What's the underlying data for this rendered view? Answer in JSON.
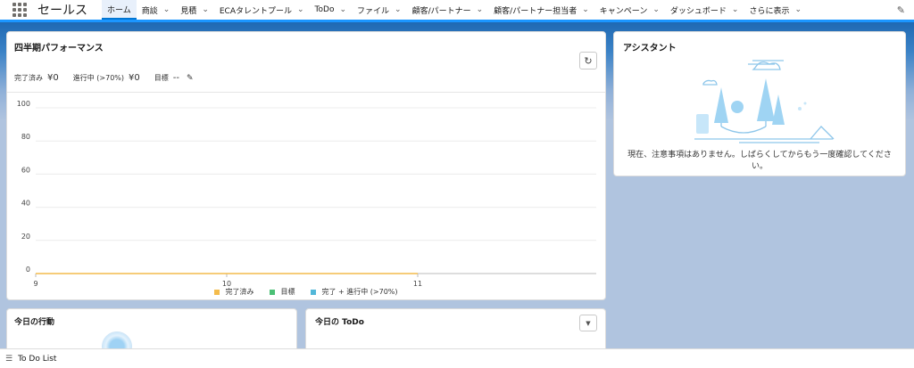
{
  "nav": {
    "app_name": "セールス",
    "tabs": [
      {
        "label": "ホーム",
        "has_menu": false,
        "active": true
      },
      {
        "label": "商談",
        "has_menu": true
      },
      {
        "label": "見積",
        "has_menu": true
      },
      {
        "label": "ECAタレントプール",
        "has_menu": true
      },
      {
        "label": "ToDo",
        "has_menu": true
      },
      {
        "label": "ファイル",
        "has_menu": true
      },
      {
        "label": "顧客/パートナー",
        "has_menu": true
      },
      {
        "label": "顧客/パートナー担当者",
        "has_menu": true
      },
      {
        "label": "キャンペーン",
        "has_menu": true
      },
      {
        "label": "ダッシュボード",
        "has_menu": true
      },
      {
        "label": "さらに表示",
        "has_menu": true
      }
    ],
    "icons": {
      "launcher": "app-launcher-icon",
      "edit": "pencil-icon"
    }
  },
  "performance": {
    "title": "四半期パフォーマンス",
    "closed_label": "完了済み",
    "closed_value": "¥0",
    "open_label": "進行中 (>70%)",
    "open_value": "¥0",
    "goal_label": "目標",
    "goal_value": "--"
  },
  "chart_data": {
    "type": "line",
    "x": [
      "9",
      "10",
      "11"
    ],
    "y_ticks": [
      0,
      20,
      40,
      60,
      80,
      100
    ],
    "ylim": [
      0,
      100
    ],
    "grid": true,
    "legend_position": "bottom",
    "series": [
      {
        "name": "完了済み",
        "color": "#f4bc4c",
        "values": [
          0,
          0,
          0
        ]
      },
      {
        "name": "目標",
        "color": "#4bc076",
        "values": []
      },
      {
        "name": "完了 + 進行中 (>70%)",
        "color": "#52b7d8",
        "values": []
      }
    ]
  },
  "assistant": {
    "title": "アシスタント",
    "message": "現在、注意事項はありません。しばらくしてからもう一度確認してください。"
  },
  "events": {
    "title": "今日の行動"
  },
  "todo": {
    "title": "今日の ToDo"
  },
  "utility": {
    "label": "To Do List"
  },
  "colors": {
    "brand_blue": "#0176d3",
    "nav_border": "#1b96ff"
  }
}
